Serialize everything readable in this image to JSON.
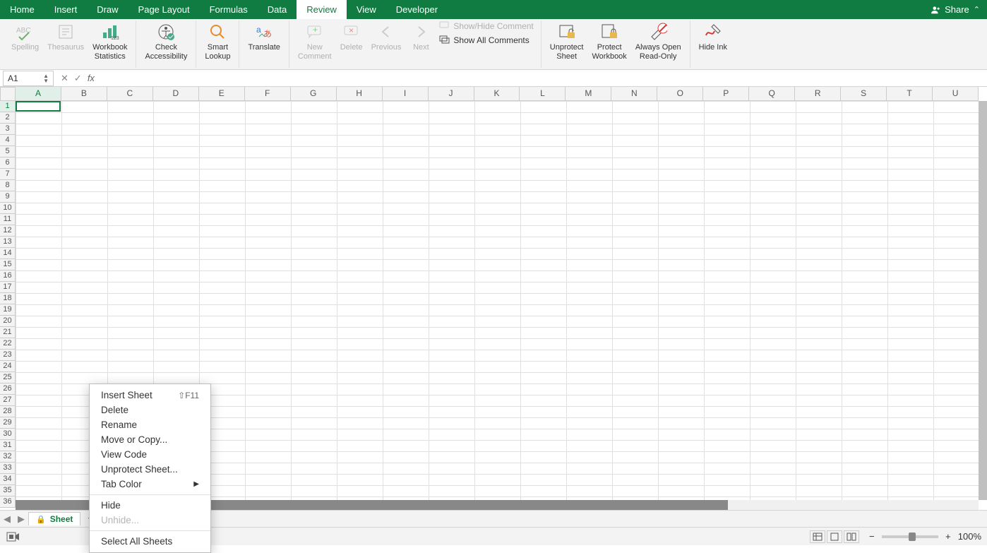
{
  "tabs": {
    "items": [
      "Home",
      "Insert",
      "Draw",
      "Page Layout",
      "Formulas",
      "Data",
      "Review",
      "View",
      "Developer"
    ],
    "active": "Review",
    "share": "Share"
  },
  "ribbon": {
    "spelling": "Spelling",
    "thesaurus": "Thesaurus",
    "wbstats": "Workbook\nStatistics",
    "check_acc": "Check\nAccessibility",
    "smart_lookup": "Smart\nLookup",
    "translate": "Translate",
    "new_comment": "New\nComment",
    "delete": "Delete",
    "previous": "Previous",
    "next": "Next",
    "show_hide_comment": "Show/Hide Comment",
    "show_all_comments": "Show All Comments",
    "unprotect_sheet": "Unprotect\nSheet",
    "protect_workbook": "Protect\nWorkbook",
    "always_open_ro": "Always Open\nRead-Only",
    "hide_ink": "Hide Ink"
  },
  "name_box": "A1",
  "fx": "fx",
  "columns": [
    "A",
    "B",
    "C",
    "D",
    "E",
    "F",
    "G",
    "H",
    "I",
    "J",
    "K",
    "L",
    "M",
    "N",
    "O",
    "P",
    "Q",
    "R",
    "S",
    "T",
    "U"
  ],
  "row_count": 36,
  "sheet": {
    "name": "Sheet"
  },
  "context_menu": {
    "insert_sheet": "Insert Sheet",
    "insert_sheet_sc": "⇧F11",
    "delete": "Delete",
    "rename": "Rename",
    "move_copy": "Move or Copy...",
    "view_code": "View Code",
    "unprotect": "Unprotect Sheet...",
    "tab_color": "Tab Color",
    "hide": "Hide",
    "unhide": "Unhide...",
    "select_all": "Select All Sheets"
  },
  "status": {
    "zoom": "100%",
    "minus": "−",
    "plus": "+"
  }
}
